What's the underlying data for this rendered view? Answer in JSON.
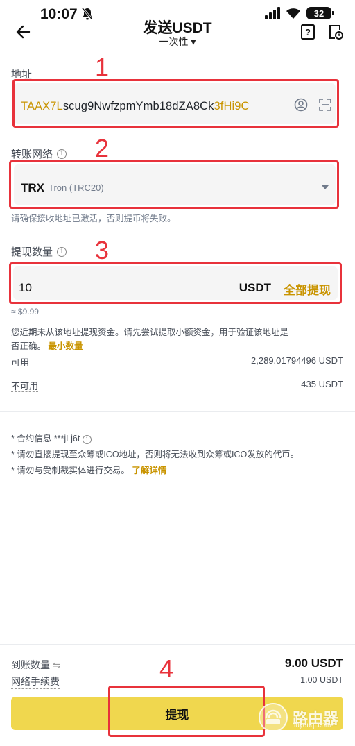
{
  "status_bar": {
    "time": "10:07",
    "battery": "32"
  },
  "header": {
    "title": "发送USDT",
    "subtitle": "一次性 ▾"
  },
  "address": {
    "label": "地址",
    "value_prefix": "TAAX7L",
    "value_middle": "scug9NwfzpmYmb18dZA8Ck",
    "value_suffix": "3fHi9C"
  },
  "network": {
    "label": "转账网络",
    "selected": "TRX",
    "selected_desc": "Tron (TRC20)",
    "hint": "请确保接收地址已激活，否则提币将失败。"
  },
  "amount": {
    "label": "提现数量",
    "value": "10",
    "unit": "USDT",
    "max_label": "全部提现",
    "approx": "≈ $9.99",
    "notice_line1": "您近期未从该地址提现资金。请先尝试提取小额资金，用于验证该地址是",
    "notice_line2": "否正确。",
    "notice_link": "最小数量"
  },
  "balances": {
    "available_label": "可用",
    "available_value": "2,289.01794496 USDT",
    "unavailable_label": "不可用",
    "unavailable_value": "435 USDT"
  },
  "notes": {
    "contract": "* 合约信息 ***jLj6t",
    "ico": "* 请勿直接提现至众筹或ICO地址，否则将无法收到众筹或ICO发放的代币。",
    "sanction": "* 请勿与受制裁实体进行交易。",
    "learn_more": "了解详情"
  },
  "summary": {
    "received_label": "到账数量",
    "received_value": "9.00 USDT",
    "fee_label": "网络手续费",
    "fee_value": "1.00 USDT"
  },
  "submit_label": "提现",
  "annotations": {
    "step1": "1",
    "step2": "2",
    "step3": "3",
    "step4": "4"
  },
  "watermark": {
    "text": "路由器",
    "sub": "luyouqi.com"
  },
  "colors": {
    "accent": "#c99400",
    "button": "#f0d74e",
    "annotation": "#e8323b"
  }
}
